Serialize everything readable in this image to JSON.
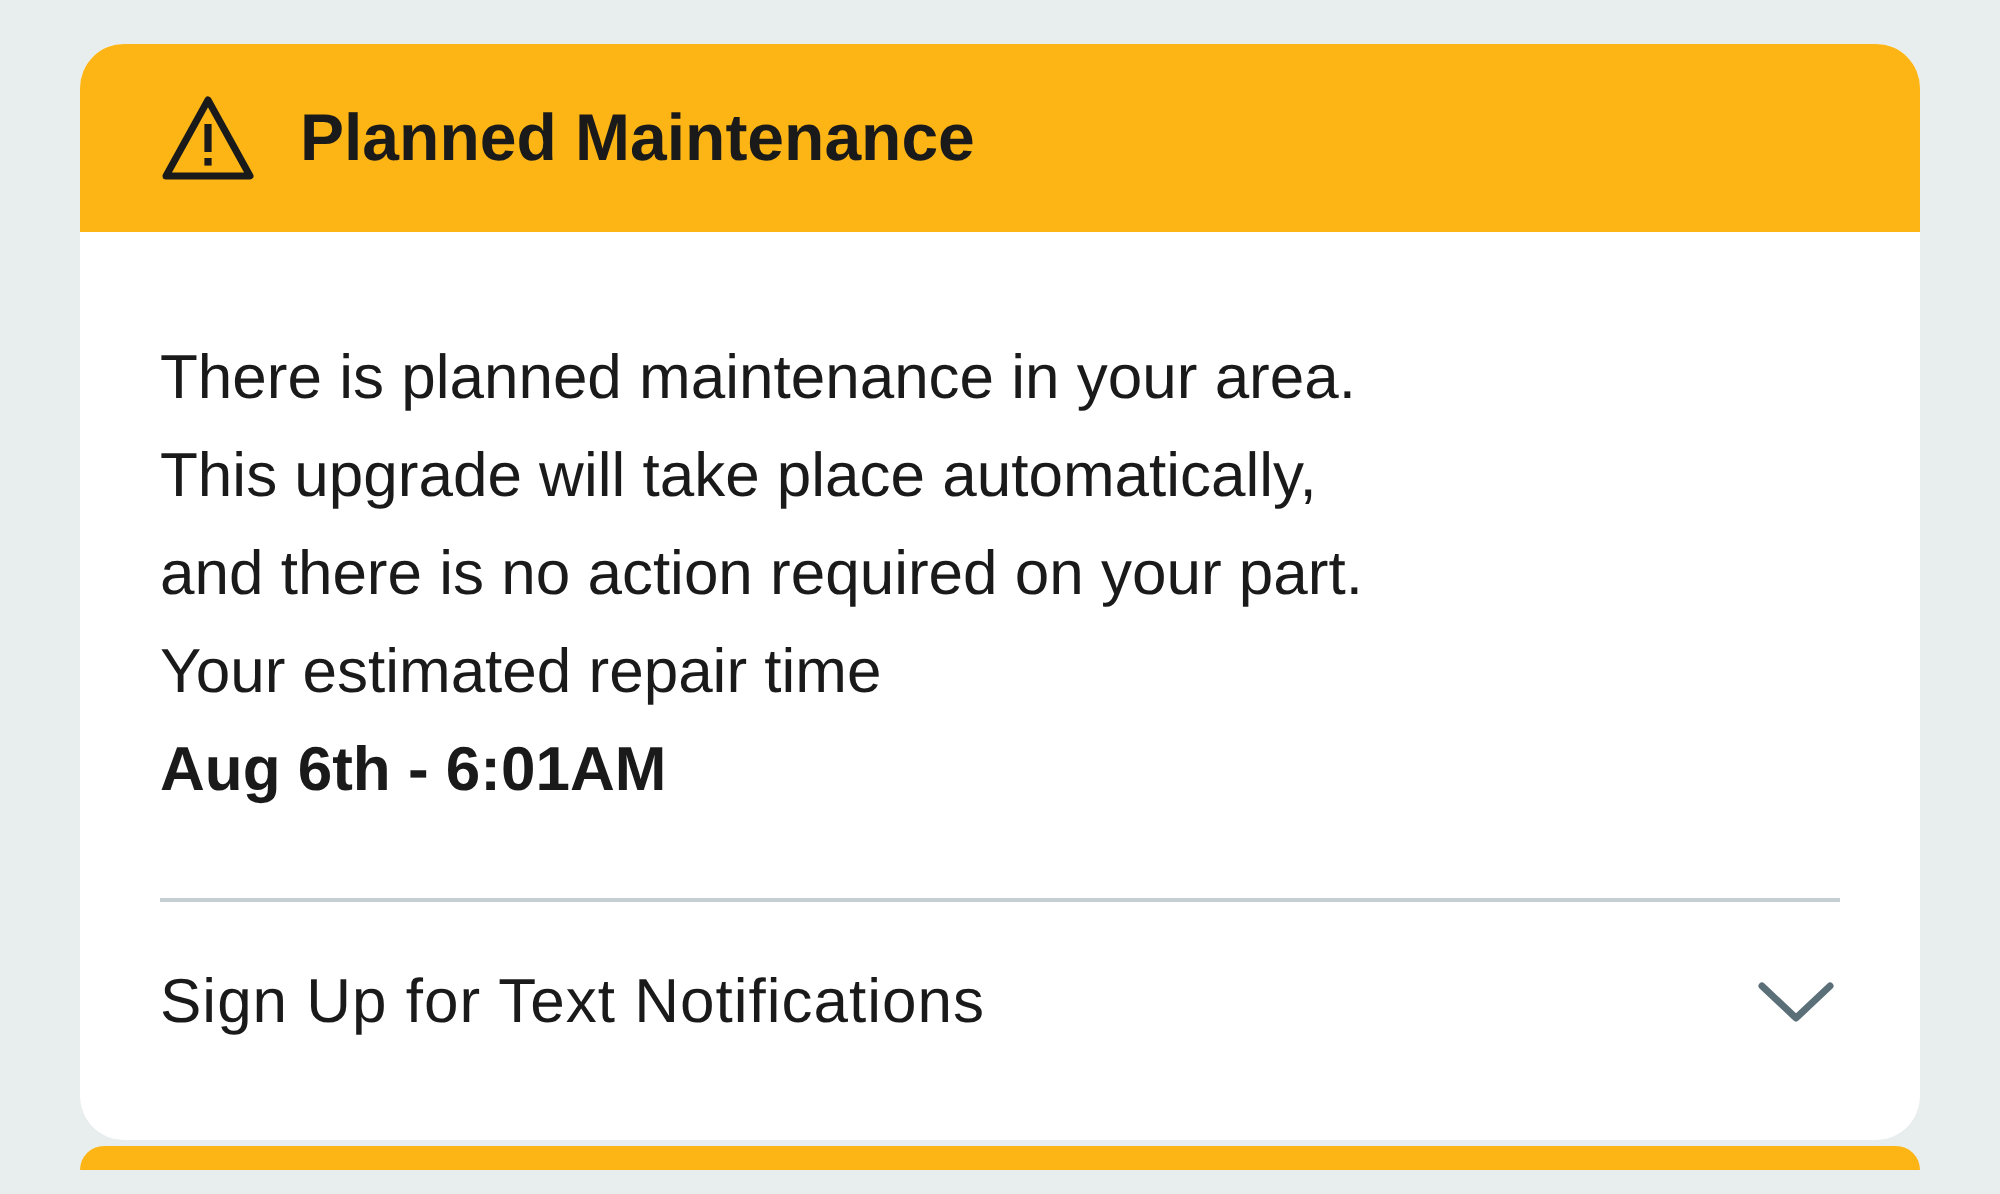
{
  "alert": {
    "title": "Planned Maintenance",
    "message": "There is planned maintenance in your area.\nThis upgrade will take place automatically,\nand there is no action required on your part.\nYour estimated repair time",
    "repair_time": "Aug 6th - 6:01AM"
  },
  "notifications": {
    "label": "Sign Up for Text Notifications",
    "expanded": false
  }
}
